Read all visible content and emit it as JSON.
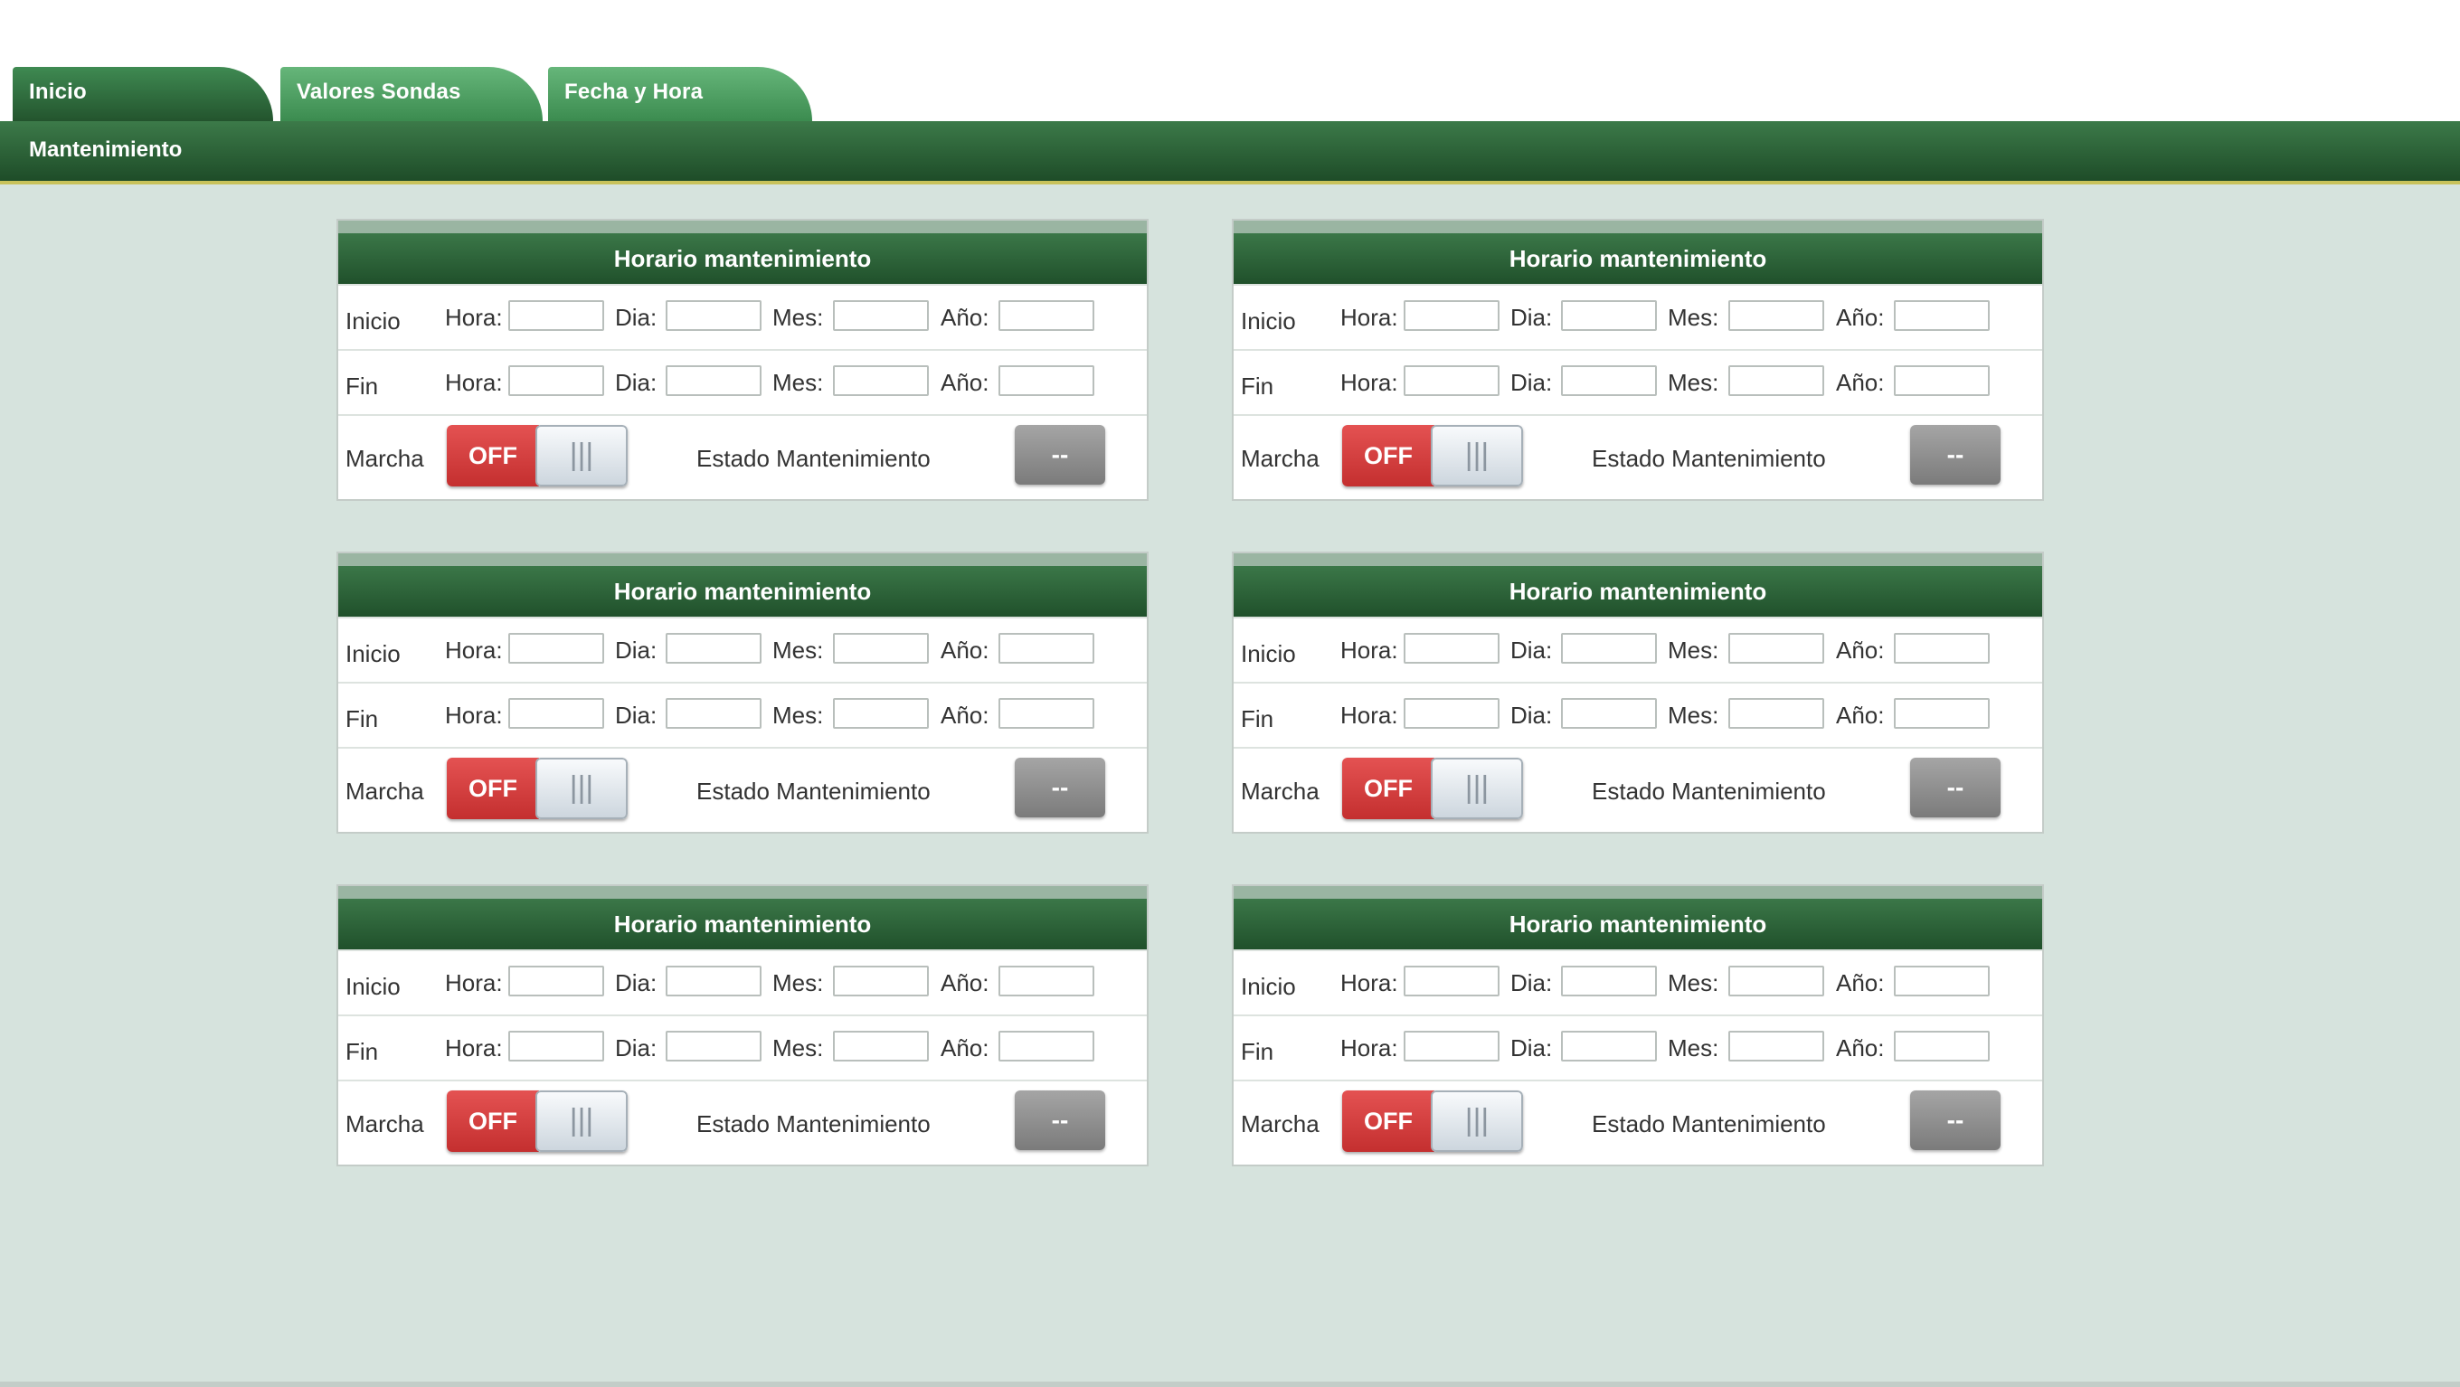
{
  "tabs": [
    {
      "label": "Inicio",
      "active": true
    },
    {
      "label": "Valores Sondas",
      "active": false
    },
    {
      "label": "Fecha y Hora",
      "active": false
    }
  ],
  "subbar": {
    "label": "Mantenimiento"
  },
  "panel_common": {
    "title": "Horario mantenimiento",
    "row_inicio": "Inicio",
    "row_fin": "Fin",
    "row_marcha": "Marcha",
    "hora": "Hora:",
    "dia": "Dia:",
    "mes": "Mes:",
    "anio": "Año:",
    "toggle_off": "OFF",
    "toggle_knob_icon": "|||",
    "estado_label": "Estado Mantenimiento",
    "estado_value": "--"
  },
  "panels": [
    {
      "title": "Horario mantenimiento",
      "inicio": {
        "hora": "",
        "dia": "",
        "mes": "",
        "anio": ""
      },
      "fin": {
        "hora": "",
        "dia": "",
        "mes": "",
        "anio": ""
      },
      "marcha": "OFF",
      "estado": "--"
    },
    {
      "title": "Horario mantenimiento",
      "inicio": {
        "hora": "",
        "dia": "",
        "mes": "",
        "anio": ""
      },
      "fin": {
        "hora": "",
        "dia": "",
        "mes": "",
        "anio": ""
      },
      "marcha": "OFF",
      "estado": "--"
    },
    {
      "title": "Horario mantenimiento",
      "inicio": {
        "hora": "",
        "dia": "",
        "mes": "",
        "anio": ""
      },
      "fin": {
        "hora": "",
        "dia": "",
        "mes": "",
        "anio": ""
      },
      "marcha": "OFF",
      "estado": "--"
    },
    {
      "title": "Horario mantenimiento",
      "inicio": {
        "hora": "",
        "dia": "",
        "mes": "",
        "anio": ""
      },
      "fin": {
        "hora": "",
        "dia": "",
        "mes": "",
        "anio": ""
      },
      "marcha": "OFF",
      "estado": "--"
    },
    {
      "title": "Horario mantenimiento",
      "inicio": {
        "hora": "",
        "dia": "",
        "mes": "",
        "anio": ""
      },
      "fin": {
        "hora": "",
        "dia": "",
        "mes": "",
        "anio": ""
      },
      "marcha": "OFF",
      "estado": "--"
    },
    {
      "title": "Horario mantenimiento",
      "inicio": {
        "hora": "",
        "dia": "",
        "mes": "",
        "anio": ""
      },
      "fin": {
        "hora": "",
        "dia": "",
        "mes": "",
        "anio": ""
      },
      "marcha": "OFF",
      "estado": "--"
    }
  ],
  "colors": {
    "header_green": "#1f4f2a",
    "tab_green": "#3a8a4e",
    "background": "#d6e3dd",
    "toggle_off_red": "#d43c3c",
    "estado_gray": "#8c8c8c"
  }
}
